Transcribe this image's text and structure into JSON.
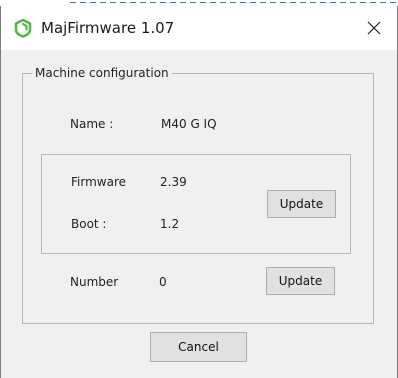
{
  "window": {
    "title": "MajFirmware 1.07",
    "icon": "app-shield-icon",
    "close_glyph": "✕",
    "accent_color": "#56b947"
  },
  "machine_config": {
    "legend": "Machine configuration",
    "name_label": "Name :",
    "name_value": "M40 G IQ",
    "firmware_label": "Firmware",
    "firmware_value": "2.39",
    "boot_label": "Boot :",
    "boot_value": "1.2",
    "firmware_update_label": "Update",
    "number_label": "Number",
    "number_value": "0",
    "number_update_label": "Update"
  },
  "footer": {
    "cancel_label": "Cancel"
  }
}
